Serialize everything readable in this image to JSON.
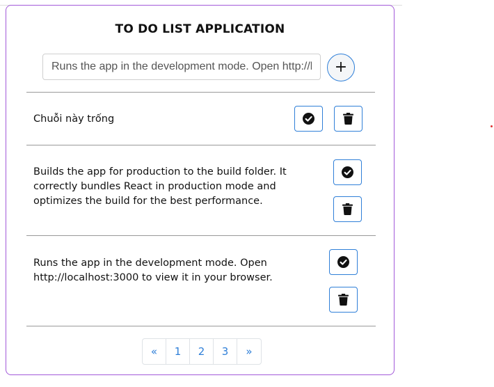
{
  "app": {
    "title": "TO DO LIST APPLICATION"
  },
  "input": {
    "value": "Runs the app in the development mode. Open http://l",
    "add_label": "+"
  },
  "todos": [
    {
      "text": "Chuỗi này trống"
    },
    {
      "text": "Builds the app for production to the build folder. It correctly bundles React in production mode and optimizes the build for the best performance."
    },
    {
      "text": "Runs the app in the development mode. Open http://localhost:3000 to view it in your browser."
    }
  ],
  "pagination": {
    "prev": "«",
    "pages": [
      "1",
      "2",
      "3"
    ],
    "next": "»"
  },
  "colors": {
    "card_border": "#a259d9",
    "button_border": "#2f7fd8",
    "link": "#2f7fd8"
  }
}
